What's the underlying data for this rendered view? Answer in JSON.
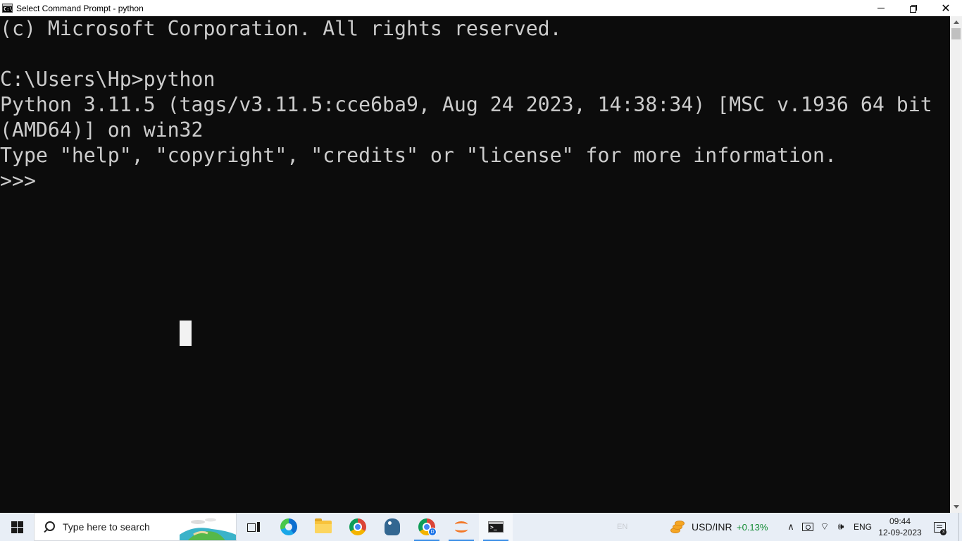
{
  "window": {
    "title": "Select Command Prompt - python",
    "icon": "cmd-icon",
    "controls": {
      "minimize": "minimize-icon",
      "restore": "restore-icon",
      "close": "close-icon"
    }
  },
  "console": {
    "lines": [
      "(c) Microsoft Corporation. All rights reserved.",
      "",
      "C:\\Users\\Hp>python",
      "Python 3.11.5 (tags/v3.11.5:cce6ba9, Aug 24 2023, 14:38:34) [MSC v.1936 64 bit",
      "(AMD64)] on win32",
      "Type \"help\", \"copyright\", \"credits\" or \"license\" for more information.",
      ">>>"
    ],
    "text_color": "#cccccc",
    "background": "#0c0c0c"
  },
  "taskbar": {
    "search_placeholder": "Type here to search",
    "pinned_apps": [
      {
        "name": "task-view",
        "icon": "task-view-icon"
      },
      {
        "name": "edge",
        "icon": "edge-icon"
      },
      {
        "name": "file-explorer",
        "icon": "folder-icon"
      },
      {
        "name": "chrome",
        "icon": "chrome-icon"
      },
      {
        "name": "postgresql",
        "icon": "elephant-icon"
      },
      {
        "name": "chrome-profile",
        "icon": "chrome-icon",
        "badge": "D"
      },
      {
        "name": "jupyter",
        "icon": "jupyter-icon"
      },
      {
        "name": "command-prompt",
        "icon": "cmd-icon"
      }
    ],
    "tray": {
      "input_indicator": "EN",
      "stock_pair": "USD/INR",
      "stock_change": "+0.13%",
      "language": "ENG",
      "time": "09:44",
      "date": "12-09-2023",
      "notification_count": "3"
    },
    "accent": "#3a8ee6",
    "positive_color": "#118a32"
  }
}
